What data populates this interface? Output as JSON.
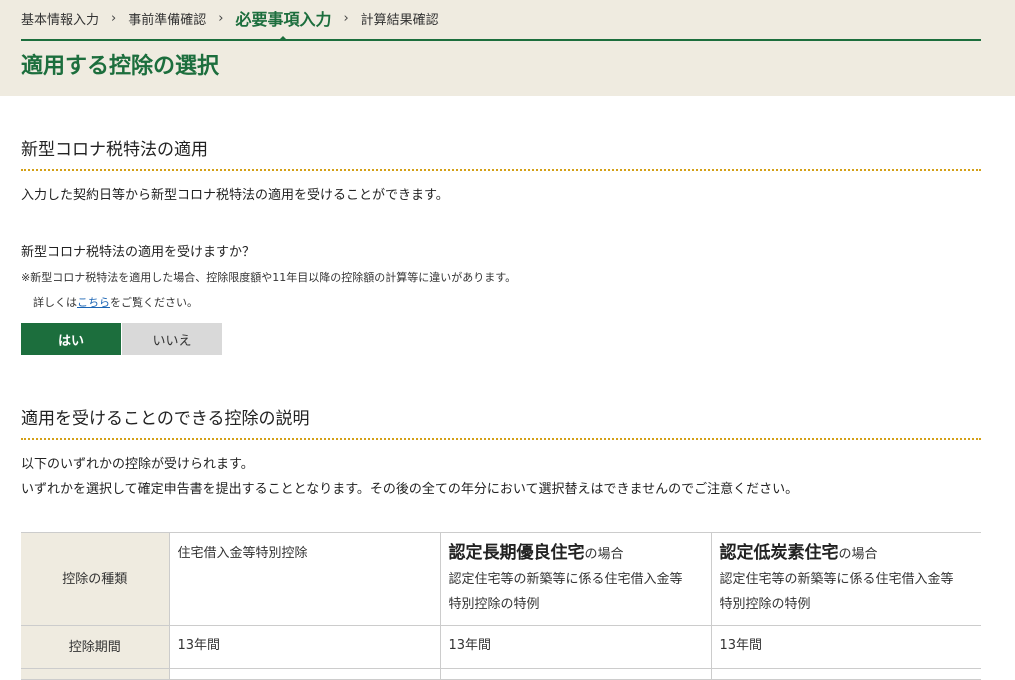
{
  "breadcrumb": {
    "steps": [
      {
        "label": "基本情報入力",
        "current": false
      },
      {
        "label": "事前準備確認",
        "current": false
      },
      {
        "label": "必要事項入力",
        "current": true
      },
      {
        "label": "計算結果確認",
        "current": false
      }
    ],
    "separator": "›"
  },
  "page_title": "適用する控除の選択",
  "corona_section": {
    "title": "新型コロナ税特法の適用",
    "description": "入力した契約日等から新型コロナ税特法の適用を受けることができます。",
    "question": "新型コロナ税特法の適用を受けますか？",
    "note": "※新型コロナ税特法を適用した場合、控除限度額や11年目以降の控除額の計算等に違いがあります。",
    "detail_prefix": "詳しくは",
    "detail_link": "こちら",
    "detail_suffix": "をご覧ください。",
    "yes_label": "はい",
    "no_label": "いいえ",
    "selected": "はい"
  },
  "explanation_section": {
    "title": "適用を受けることのできる控除の説明",
    "line1": "以下のいずれかの控除が受けられます。",
    "line2": "いずれかを選択して確定申告書を提出することとなります。その後の全ての年分において選択替えはできませんのでご注意ください。"
  },
  "table": {
    "row_type_header": "控除の種類",
    "row_period_header": "控除期間",
    "columns": [
      {
        "strong": "",
        "suffix": "",
        "lines": [
          "住宅借入金等特別控除"
        ],
        "period": "13年間"
      },
      {
        "strong": "認定長期優良住宅",
        "suffix": "の場合",
        "lines": [
          "認定住宅等の新築等に係る住宅借入金等",
          "特別控除の特例"
        ],
        "period": "13年間"
      },
      {
        "strong": "認定低炭素住宅",
        "suffix": "の場合",
        "lines": [
          "認定住宅等の新築等に係る住宅借入金等",
          "特別控除の特例"
        ],
        "period": "13年間"
      }
    ]
  },
  "colors": {
    "accent_green": "#1c6e3d",
    "header_beige": "#efebe0",
    "dotted_rule": "#d4a017",
    "link_blue": "#1a64b4"
  }
}
